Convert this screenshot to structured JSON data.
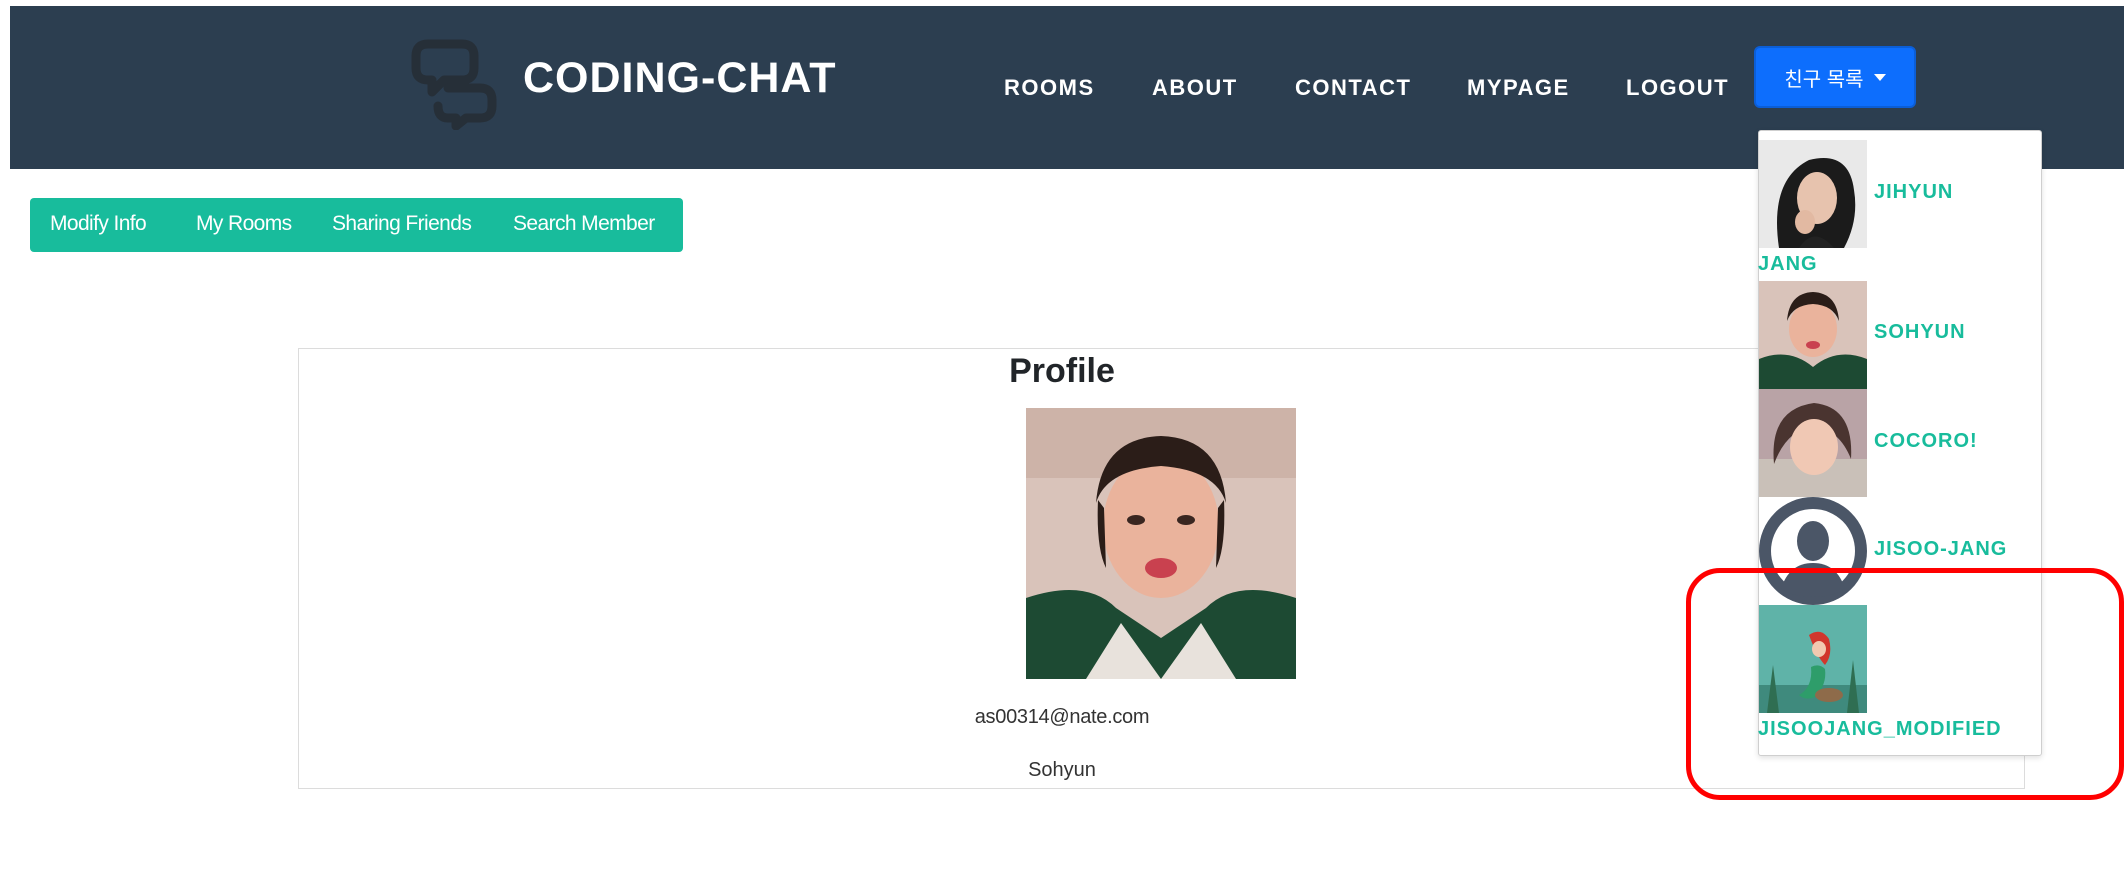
{
  "brand": {
    "title": "CODING-CHAT",
    "icon": "chat-bubbles-icon"
  },
  "nav": {
    "items": [
      "ROOMS",
      "ABOUT",
      "CONTACT",
      "MYPAGE",
      "LOGOUT"
    ]
  },
  "friend_button": {
    "label": "친구 목록"
  },
  "subnav": {
    "items": [
      "Modify Info",
      "My Rooms",
      "Sharing Friends",
      "Search Member"
    ]
  },
  "profile": {
    "title": "Profile",
    "email": "as00314@nate.com",
    "name": "Sohyun"
  },
  "friends": [
    {
      "name_line1": "JIHYUN",
      "name_line2": "JANG"
    },
    {
      "name_line1": "SOHYUN"
    },
    {
      "name_line1": "COCORO!"
    },
    {
      "name_line1": "JISOO-JANG"
    },
    {
      "name_line1": "JISOOJANG_MODIFIED"
    }
  ],
  "colors": {
    "navbar": "#2c3e50",
    "accent": "#18bc9c",
    "button": "#0d6efd",
    "highlight": "#ff0000"
  }
}
